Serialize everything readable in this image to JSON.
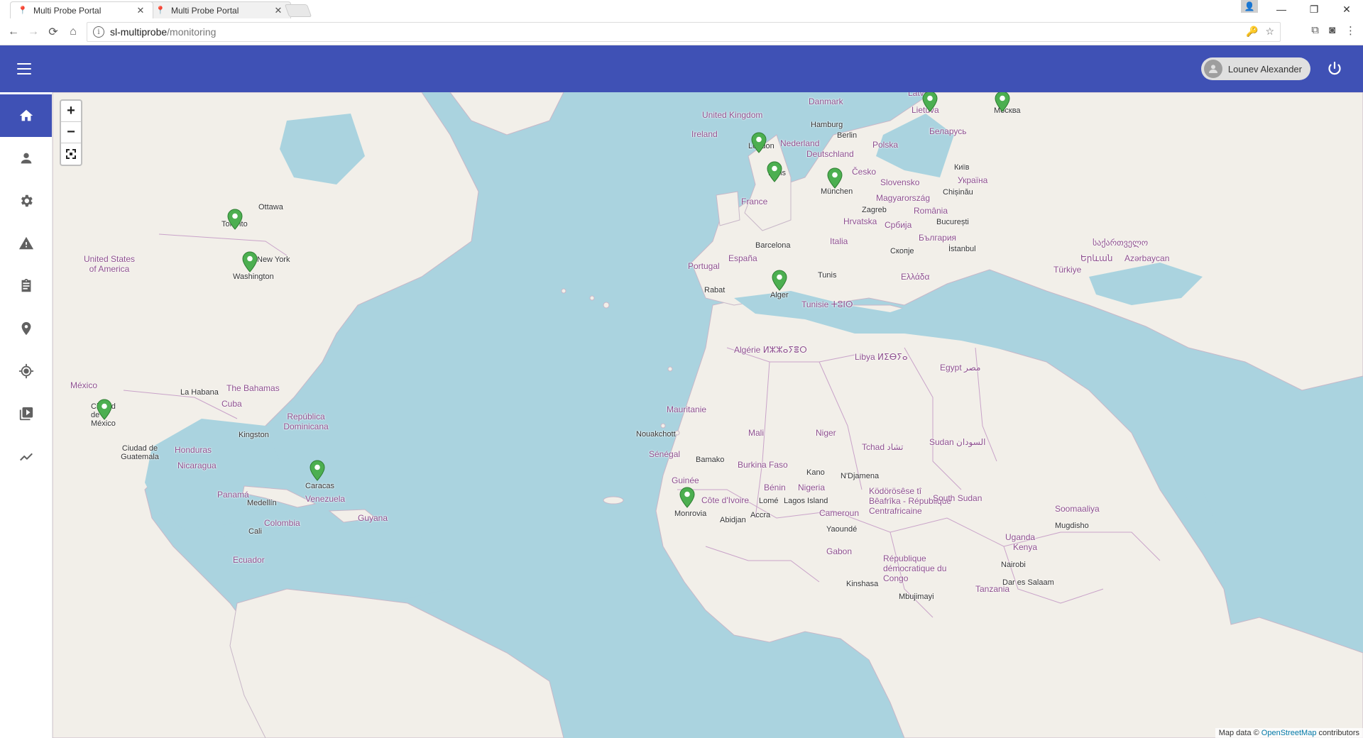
{
  "browser": {
    "tabs": [
      {
        "title": "Multi Probe Portal",
        "active": true
      },
      {
        "title": "Multi Probe Portal",
        "active": false
      }
    ],
    "url_host": "sl-multiprobe",
    "url_path": "/monitoring"
  },
  "header": {
    "user_name": "Lounev Alexander",
    "color": "#3f51b5"
  },
  "sidebar": {
    "items": [
      {
        "icon": "home-icon",
        "active": true
      },
      {
        "icon": "person-icon",
        "active": false
      },
      {
        "icon": "gear-icon",
        "active": false
      },
      {
        "icon": "warning-icon",
        "active": false
      },
      {
        "icon": "clipboard-icon",
        "active": false
      },
      {
        "icon": "location-pin-icon",
        "active": false
      },
      {
        "icon": "gps-target-icon",
        "active": false
      },
      {
        "icon": "video-library-icon",
        "active": false
      },
      {
        "icon": "trending-line-icon",
        "active": false
      }
    ]
  },
  "map": {
    "zoom_in": "+",
    "zoom_out": "−",
    "labels": {
      "united_kingdom": "United Kingdom",
      "ireland": "Ireland",
      "danmark": "Danmark",
      "latvija": "Latvija",
      "lietuva": "Lietuva",
      "moskva": "Москва",
      "hamburg": "Hamburg",
      "berlin": "Berlin",
      "nederland": "Nederland",
      "deutschland": "Deutschland",
      "polska": "Polska",
      "belarus": "Беларусь",
      "london": "London",
      "paris": "Paris",
      "cesko": "Česko",
      "kyiv": "Київ",
      "ukraina": "Україна",
      "munchen": "München",
      "slovensko": "Slovensko",
      "magyarorszag": "Magyarország",
      "chisinau": "Chișinău",
      "france": "France",
      "zagreb": "Zagreb",
      "romania": "România",
      "hrvatska": "Hrvatska",
      "srbija": "Србија",
      "bucuresti": "București",
      "bulgaria": "България",
      "italia": "Italia",
      "skopje": "Скопје",
      "istanbul": "İstanbul",
      "barcelona": "Barcelona",
      "espana": "España",
      "portugal": "Portugal",
      "turkiye": "Türkiye",
      "ellada": "Ελλάδα",
      "tunis": "Tunis",
      "rabat": "Rabat",
      "alger": "Alger",
      "tunisie": "Tunisie ⵜⵓⵏⵙ",
      "algerie": "Algérie ⵍⵣⵣⴰⵢⴻⵔ",
      "libya": "Libya ⵍⵉⴱⵢⴰ",
      "egypt": "Egypt مصر",
      "mauritanie": "Mauritanie",
      "mali": "Mali",
      "niger": "Niger",
      "nouakchott": "Nouakchott",
      "senegal": "Sénégal",
      "bamako": "Bamako",
      "tchad": "Tchad تشاد",
      "sudan": "Sudan السودان",
      "burkina": "Burkina Faso",
      "kano": "Kano",
      "ndjamena": "N'Djamena",
      "guinee": "Guinée",
      "benin": "Bénin",
      "nigeria": "Nigeria",
      "monrovia": "Monrovia",
      "cote_divoire": "Côte d'Ivoire",
      "lome": "Lomé",
      "lagos": "Lagos Island",
      "abidjan": "Abidjan",
      "accra": "Accra",
      "cameroun": "Cameroun",
      "yaounde": "Yaoundé",
      "centrafrique": "Ködörösêse tî Bêafrîka - République Centrafricaine",
      "south_sudan": "South Sudan",
      "gabon": "Gabon",
      "rdc": "République démocratique du Congo",
      "kinshasa": "Kinshasa",
      "uganda": "Uganda",
      "kenya": "Kenya",
      "nairobi": "Nairobi",
      "tanzania": "Tanzania",
      "dar": "Dar es Salaam",
      "mbujimayi": "Mbujimayi",
      "somaliya": "Soomaaliya",
      "mugdisho": "Mugdisho",
      "ottawa": "Ottawa",
      "toronto": "Toronto",
      "new_york": "New York",
      "washington": "Washington",
      "usa": "United States of America",
      "mexico": "México",
      "ciudad_mexico": "Ciudad de México",
      "la_habana": "La Habana",
      "bahamas": "The Bahamas",
      "cuba": "Cuba",
      "dominicana": "República Dominicana",
      "kingston": "Kingston",
      "guatemala": "Ciudad de Guatemala",
      "honduras": "Honduras",
      "nicaragua": "Nicaragua",
      "panama": "Panamá",
      "caracas": "Caracas",
      "venezuela": "Venezuela",
      "medellin": "Medellín",
      "colombia": "Colombia",
      "guyana": "Guyana",
      "cali": "Cali",
      "ecuador": "Ecuador",
      "sakartvelo": "საქართველო",
      "azarbaycan": "Azərbaycan",
      "yerevan": "Երևան"
    },
    "attribution_prefix": "Map data ©",
    "attribution_link": "OpenStreetMap",
    "attribution_suffix": "contributors",
    "marker_color": "#4caf50"
  }
}
